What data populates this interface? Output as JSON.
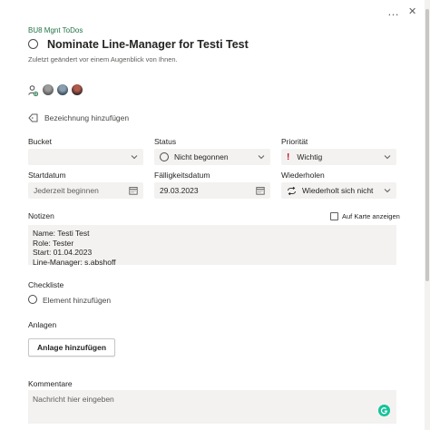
{
  "topbar": {
    "more_icon": "…",
    "close_icon": "✕"
  },
  "header": {
    "plan_name": "BU8 Mgnt ToDos",
    "task_title": "Nominate Line-Manager for Testi Test",
    "modified_text": "Zuletzt geändert vor einem Augenblick von Ihnen."
  },
  "labels": {
    "add_label": "Bezeichnung hinzufügen"
  },
  "fields": {
    "bucket_label": "Bucket",
    "bucket_value": "",
    "status_label": "Status",
    "status_value": "Nicht begonnen",
    "priority_label": "Priorität",
    "priority_value": "Wichtig",
    "start_label": "Startdatum",
    "start_value": "Jederzeit beginnen",
    "due_label": "Fälligkeitsdatum",
    "due_value": "29.03.2023",
    "repeat_label": "Wiederholen",
    "repeat_value": "Wiederholt sich nicht"
  },
  "notes": {
    "label": "Notizen",
    "show_on_card": "Auf Karte anzeigen",
    "lines": [
      "Name: Testi Test",
      "Role: Tester",
      "Start: 01.04.2023",
      "Line-Manager: s.abshoff"
    ]
  },
  "checklist": {
    "label": "Checkliste",
    "add_item": "Element hinzufügen"
  },
  "attachments": {
    "label": "Anlagen",
    "add_button": "Anlage hinzufügen"
  },
  "comments": {
    "label": "Kommentare",
    "placeholder": "Nachricht hier eingeben"
  },
  "colors": {
    "plan_green": "#217346",
    "priority_red": "#c50f1f",
    "field_bg": "#f3f2f1"
  }
}
